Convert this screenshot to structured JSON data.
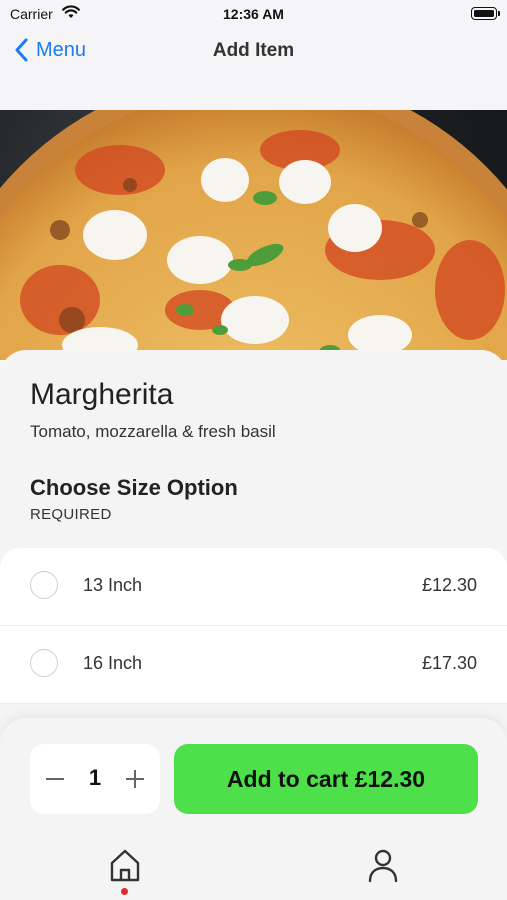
{
  "status_bar": {
    "carrier": "Carrier",
    "time": "12:36 AM",
    "icons": [
      "wifi-icon",
      "battery-icon"
    ]
  },
  "nav": {
    "back_label": "Menu",
    "back_icon": "chevron-left-icon",
    "title": "Add Item",
    "accent_color": "#1a7cf0"
  },
  "hero": {
    "image": "pizza-photo"
  },
  "item": {
    "name": "Margherita",
    "description": "Tomato, mozzarella & fresh basil"
  },
  "size_section": {
    "title": "Choose Size Option",
    "subtitle": "REQUIRED",
    "options": [
      {
        "label": "13 Inch",
        "price": "£12.30",
        "selected": false
      },
      {
        "label": "16 Inch",
        "price": "£17.30",
        "selected": false
      }
    ]
  },
  "footer": {
    "quantity": "1",
    "add_to_cart_label": "Add to cart £12.30",
    "button_color": "#4ee04a"
  },
  "tab_bar": {
    "items": [
      {
        "icon": "home-icon",
        "active": true
      },
      {
        "icon": "profile-icon",
        "active": false
      }
    ],
    "indicator_color": "#e8262e"
  }
}
